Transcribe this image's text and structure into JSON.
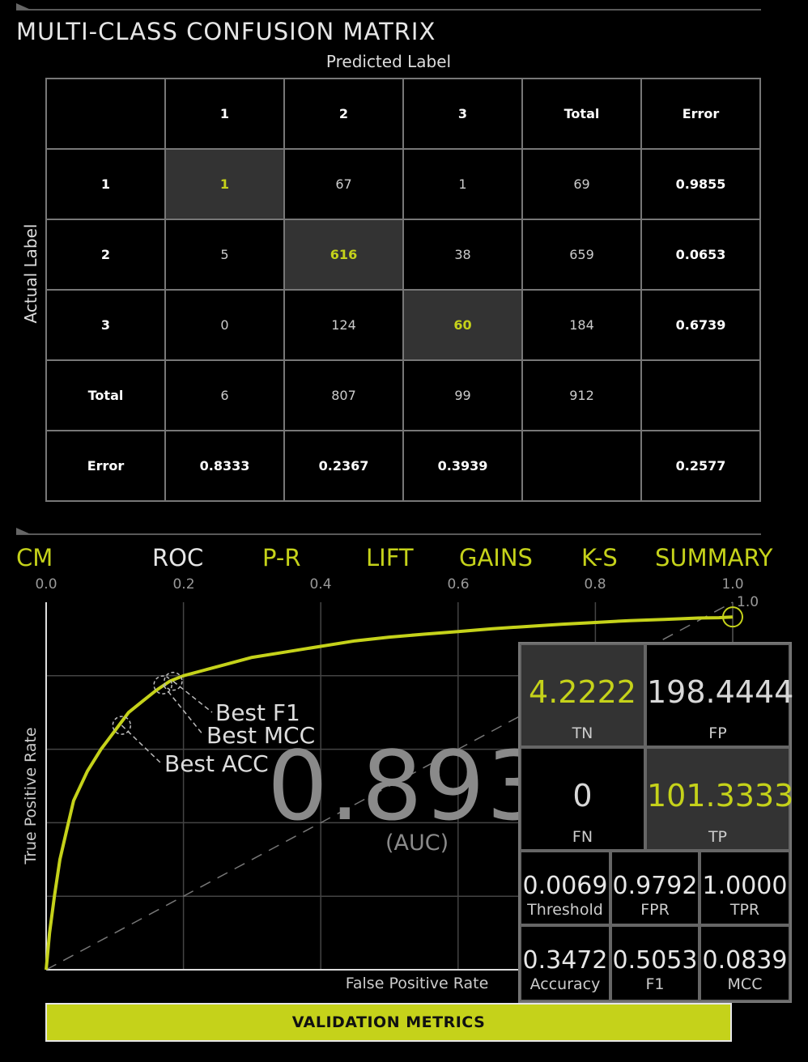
{
  "confusion_matrix": {
    "title": "MULTI-CLASS CONFUSION MATRIX",
    "predicted_label": "Predicted Label",
    "actual_label": "Actual Label",
    "header": [
      "",
      "1",
      "2",
      "3",
      "Total",
      "Error"
    ],
    "rows": [
      [
        "1",
        "1",
        "67",
        "1",
        "69",
        "0.9855"
      ],
      [
        "2",
        "5",
        "616",
        "38",
        "659",
        "0.0653"
      ],
      [
        "3",
        "0",
        "124",
        "60",
        "184",
        "0.6739"
      ],
      [
        "Total",
        "6",
        "807",
        "99",
        "912",
        ""
      ],
      [
        "Error",
        "0.8333",
        "0.2367",
        "0.3939",
        "",
        "0.2577"
      ]
    ],
    "accent_color": "#c5d21a"
  },
  "tabs": [
    "CM",
    "ROC",
    "P-R",
    "LIFT",
    "GAINS",
    "K-S",
    "SUMMARY"
  ],
  "active_tab": "ROC",
  "chart_data": {
    "type": "line",
    "xlabel": "False Positive Rate",
    "ylabel": "True Positive Rate",
    "x_ticks": [
      "0.0",
      "0.2",
      "0.4",
      "0.6",
      "0.8",
      "1.0"
    ],
    "y_top_label": "1.0",
    "xlim": [
      0,
      1
    ],
    "ylim": [
      0,
      1
    ],
    "grid": true,
    "series": [
      {
        "color": "#c5d21a",
        "points": [
          [
            0,
            0
          ],
          [
            0.005,
            0.1
          ],
          [
            0.012,
            0.2
          ],
          [
            0.02,
            0.3
          ],
          [
            0.03,
            0.38
          ],
          [
            0.04,
            0.46
          ],
          [
            0.06,
            0.54
          ],
          [
            0.08,
            0.6
          ],
          [
            0.1,
            0.65
          ],
          [
            0.12,
            0.7
          ],
          [
            0.14,
            0.73
          ],
          [
            0.16,
            0.76
          ],
          [
            0.18,
            0.785
          ],
          [
            0.2,
            0.8
          ],
          [
            0.23,
            0.815
          ],
          [
            0.26,
            0.83
          ],
          [
            0.3,
            0.85
          ],
          [
            0.35,
            0.865
          ],
          [
            0.4,
            0.88
          ],
          [
            0.45,
            0.895
          ],
          [
            0.5,
            0.905
          ],
          [
            0.55,
            0.913
          ],
          [
            0.6,
            0.92
          ],
          [
            0.65,
            0.928
          ],
          [
            0.7,
            0.934
          ],
          [
            0.75,
            0.94
          ],
          [
            0.8,
            0.945
          ],
          [
            0.85,
            0.95
          ],
          [
            0.9,
            0.953
          ],
          [
            0.95,
            0.957
          ],
          [
            0.98,
            0.958
          ],
          [
            1,
            0.96
          ]
        ]
      }
    ],
    "diagonal": true,
    "annotations": [
      {
        "label": "Best ACC",
        "x": 0.11,
        "y": 0.665
      },
      {
        "label": "Best MCC",
        "x": 0.17,
        "y": 0.775
      },
      {
        "label": "Best F1",
        "x": 0.185,
        "y": 0.785
      }
    ],
    "auc_value": "0.893",
    "auc_label": "(AUC)"
  },
  "metrics": {
    "tn": {
      "value": "4.2222",
      "label": "TN"
    },
    "fp": {
      "value": "198.4444",
      "label": "FP"
    },
    "fn": {
      "value": "0",
      "label": "FN"
    },
    "tp": {
      "value": "101.3333",
      "label": "TP"
    },
    "threshold": {
      "value": "0.0069",
      "label": "Threshold"
    },
    "fpr": {
      "value": "0.9792",
      "label": "FPR"
    },
    "tpr": {
      "value": "1.0000",
      "label": "TPR"
    },
    "accuracy": {
      "value": "0.3472",
      "label": "Accuracy"
    },
    "f1": {
      "value": "0.5053",
      "label": "F1"
    },
    "mcc": {
      "value": "0.0839",
      "label": "MCC"
    }
  },
  "validation_button": "VALIDATION METRICS"
}
